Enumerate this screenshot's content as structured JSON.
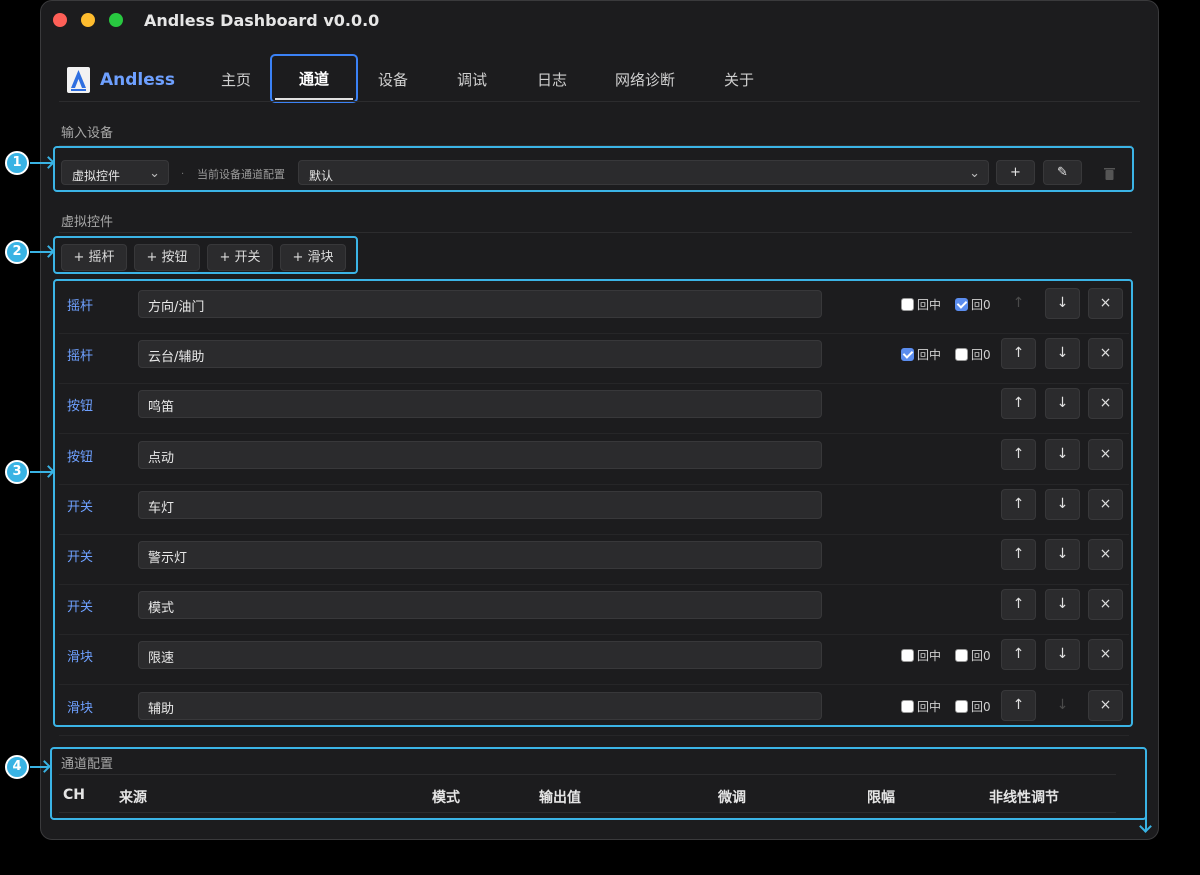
{
  "window": {
    "title": "Andless Dashboard v0.0.0"
  },
  "brand": {
    "name": "Andless"
  },
  "nav": {
    "tabs": [
      "主页",
      "通道",
      "设备",
      "调试",
      "日志",
      "网络诊断",
      "关于"
    ],
    "active": "通道"
  },
  "input_device": {
    "section_label": "输入设备",
    "device_select": "虚拟控件",
    "config_label": "当前设备通道配置",
    "config_select": "默认",
    "add_label": "+",
    "edit_label": "✎"
  },
  "virtual_controls": {
    "section_label": "虚拟控件",
    "add_buttons": [
      "+ 摇杆",
      "+ 按钮",
      "+ 开关",
      "+ 滑块"
    ],
    "rows": [
      {
        "type": "摇杆",
        "name": "方向/油门",
        "center_label": "回中",
        "zero_label": "回0",
        "center_checked": false,
        "zero_checked": true,
        "show_checks": true,
        "up_enabled": false,
        "down_enabled": true
      },
      {
        "type": "摇杆",
        "name": "云台/辅助",
        "center_label": "回中",
        "zero_label": "回0",
        "center_checked": true,
        "zero_checked": false,
        "show_checks": true,
        "up_enabled": true,
        "down_enabled": true
      },
      {
        "type": "按钮",
        "name": "鸣笛",
        "show_checks": false,
        "up_enabled": true,
        "down_enabled": true
      },
      {
        "type": "按钮",
        "name": "点动",
        "show_checks": false,
        "up_enabled": true,
        "down_enabled": true
      },
      {
        "type": "开关",
        "name": "车灯",
        "show_checks": false,
        "up_enabled": true,
        "down_enabled": true
      },
      {
        "type": "开关",
        "name": "警示灯",
        "show_checks": false,
        "up_enabled": true,
        "down_enabled": true
      },
      {
        "type": "开关",
        "name": "模式",
        "show_checks": false,
        "up_enabled": true,
        "down_enabled": true
      },
      {
        "type": "滑块",
        "name": "限速",
        "center_label": "回中",
        "zero_label": "回0",
        "center_checked": false,
        "zero_checked": false,
        "show_checks": true,
        "up_enabled": true,
        "down_enabled": true
      },
      {
        "type": "滑块",
        "name": "辅助",
        "center_label": "回中",
        "zero_label": "回0",
        "center_checked": false,
        "zero_checked": false,
        "show_checks": true,
        "up_enabled": true,
        "down_enabled": false
      }
    ],
    "up_glyph": "↑",
    "down_glyph": "↓",
    "remove_glyph": "×"
  },
  "channel_config": {
    "section_label": "通道配置",
    "columns": [
      "CH",
      "来源",
      "模式",
      "输出值",
      "微调",
      "限幅",
      "非线性调节"
    ]
  },
  "annotations": [
    "1",
    "2",
    "3",
    "4"
  ],
  "colors": {
    "accent": "#3b82f6",
    "annotation": "#39b3e4",
    "type_label": "#6ea0ff"
  }
}
